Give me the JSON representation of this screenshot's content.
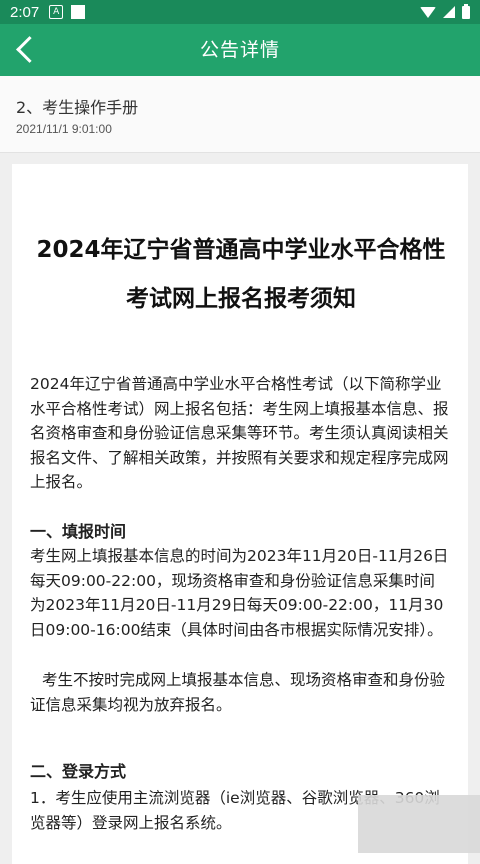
{
  "status_bar": {
    "time": "2:07",
    "icons": [
      "notification-a-icon",
      "square-icon",
      "wifi-icon",
      "signal-icon",
      "battery-icon"
    ]
  },
  "app_bar": {
    "title": "公告详情",
    "back_icon": "back-chevron-icon"
  },
  "header": {
    "title": "2、考生操作手册",
    "date": "2021/11/1 9:01:00"
  },
  "article": {
    "heading": "2024年辽宁省普通高中学业水平合格性考试网上报名报考须知",
    "intro": "2024年辽宁省普通高中学业水平合格性考试（以下简称学业水平合格性考试）网上报名包括：考生网上填报基本信息、报名资格审查和身份验证信息采集等环节。考生须认真阅读相关报名文件、了解相关政策，并按照有关要求和规定程序完成网上报名。",
    "section1_title": "一、填报时间",
    "section1_text": "考生网上填报基本信息的时间为2023年11月20日-11月26日每天09:00-22:00，现场资格审查和身份验证信息采集时间为2023年11月20日-11月29日每天09:00-22:00，11月30日09:00-16:00结束（具体时间由各市根据实际情况安排）。",
    "section1_note": "考生不按时完成网上填报基本信息、现场资格审查和身份验证信息采集均视为放弃报名。",
    "section2_title": "二、登录方式",
    "section2_text": "1．考生应使用主流浏览器（ie浏览器、谷歌浏览器、360浏览器等）登录网上报名系统。"
  },
  "colors": {
    "status_bar": "#1a8a5a",
    "app_bar": "#22a36c",
    "background": "#efefef"
  }
}
